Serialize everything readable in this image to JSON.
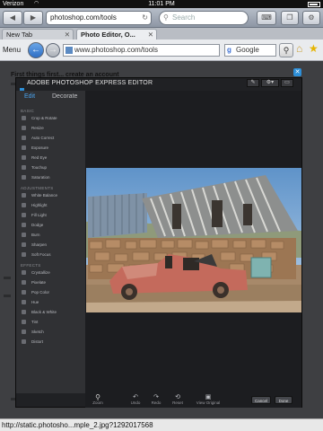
{
  "ios": {
    "carrier": "Verizon",
    "time": "11:01 PM",
    "url": "photoshop.com/tools",
    "search_placeholder": "Search"
  },
  "tabs": [
    {
      "label": "New Tab"
    },
    {
      "label": "Photo Editor, O..."
    }
  ],
  "browser": {
    "menu_label": "Menu",
    "address": "www.photoshop.com/tools",
    "search_engine": "Google"
  },
  "page": {
    "heading": "First things first... create an account"
  },
  "editor": {
    "title": "ADOBE PHOTOSHOP EXPRESS EDITOR",
    "tab_edit": "Edit",
    "tab_decorate": "Decorate",
    "sections": [
      {
        "title": "BASIC",
        "items": [
          "Crop & Rotate",
          "Resize",
          "Auto Correct",
          "Exposure",
          "Red Eye",
          "Touchup",
          "Saturation"
        ]
      },
      {
        "title": "ADJUSTMENTS",
        "items": [
          "White Balance",
          "Highlight",
          "Fill Light",
          "Dodge",
          "Burn",
          "Sharpen",
          "Soft Focus"
        ]
      },
      {
        "title": "EFFECTS",
        "items": [
          "Crystallize",
          "Pixelate",
          "Pop Color",
          "Hue",
          "Black & White",
          "Tint",
          "Sketch",
          "Distort"
        ]
      }
    ],
    "bottom": {
      "zoom": "Zoom",
      "undo": "Undo",
      "redo": "Redo",
      "reset": "Reset",
      "view_original": "View Original",
      "cancel": "Cancel",
      "done": "Done"
    }
  },
  "status_url": "http://static.photosho...mple_2.jpg?1292017568",
  "colors": {
    "edit_accent": "#4aa3ee",
    "close_blue": "#2d8fd8"
  }
}
